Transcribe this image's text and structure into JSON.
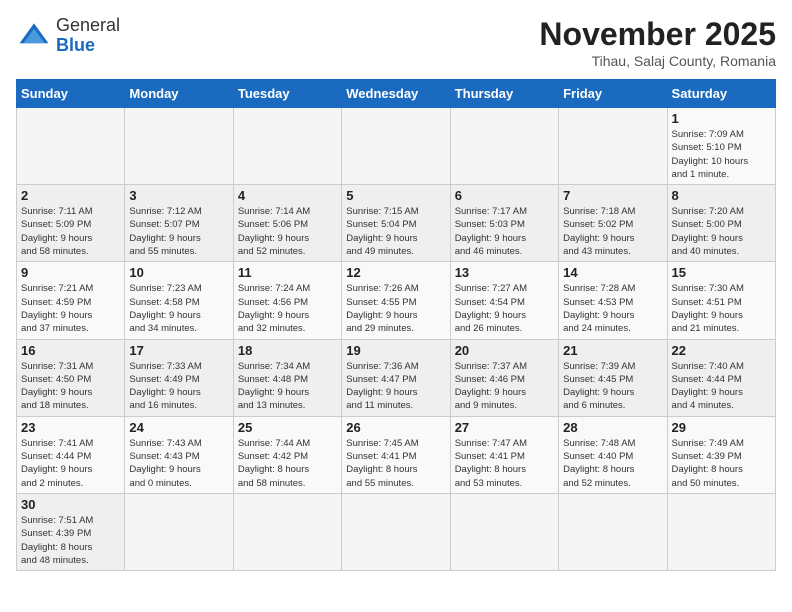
{
  "header": {
    "logo_general": "General",
    "logo_blue": "Blue",
    "month_year": "November 2025",
    "location": "Tihau, Salaj County, Romania"
  },
  "weekdays": [
    "Sunday",
    "Monday",
    "Tuesday",
    "Wednesday",
    "Thursday",
    "Friday",
    "Saturday"
  ],
  "weeks": [
    [
      {
        "day": "",
        "info": ""
      },
      {
        "day": "",
        "info": ""
      },
      {
        "day": "",
        "info": ""
      },
      {
        "day": "",
        "info": ""
      },
      {
        "day": "",
        "info": ""
      },
      {
        "day": "",
        "info": ""
      },
      {
        "day": "1",
        "info": "Sunrise: 7:09 AM\nSunset: 5:10 PM\nDaylight: 10 hours\nand 1 minute."
      }
    ],
    [
      {
        "day": "2",
        "info": "Sunrise: 7:11 AM\nSunset: 5:09 PM\nDaylight: 9 hours\nand 58 minutes."
      },
      {
        "day": "3",
        "info": "Sunrise: 7:12 AM\nSunset: 5:07 PM\nDaylight: 9 hours\nand 55 minutes."
      },
      {
        "day": "4",
        "info": "Sunrise: 7:14 AM\nSunset: 5:06 PM\nDaylight: 9 hours\nand 52 minutes."
      },
      {
        "day": "5",
        "info": "Sunrise: 7:15 AM\nSunset: 5:04 PM\nDaylight: 9 hours\nand 49 minutes."
      },
      {
        "day": "6",
        "info": "Sunrise: 7:17 AM\nSunset: 5:03 PM\nDaylight: 9 hours\nand 46 minutes."
      },
      {
        "day": "7",
        "info": "Sunrise: 7:18 AM\nSunset: 5:02 PM\nDaylight: 9 hours\nand 43 minutes."
      },
      {
        "day": "8",
        "info": "Sunrise: 7:20 AM\nSunset: 5:00 PM\nDaylight: 9 hours\nand 40 minutes."
      }
    ],
    [
      {
        "day": "9",
        "info": "Sunrise: 7:21 AM\nSunset: 4:59 PM\nDaylight: 9 hours\nand 37 minutes."
      },
      {
        "day": "10",
        "info": "Sunrise: 7:23 AM\nSunset: 4:58 PM\nDaylight: 9 hours\nand 34 minutes."
      },
      {
        "day": "11",
        "info": "Sunrise: 7:24 AM\nSunset: 4:56 PM\nDaylight: 9 hours\nand 32 minutes."
      },
      {
        "day": "12",
        "info": "Sunrise: 7:26 AM\nSunset: 4:55 PM\nDaylight: 9 hours\nand 29 minutes."
      },
      {
        "day": "13",
        "info": "Sunrise: 7:27 AM\nSunset: 4:54 PM\nDaylight: 9 hours\nand 26 minutes."
      },
      {
        "day": "14",
        "info": "Sunrise: 7:28 AM\nSunset: 4:53 PM\nDaylight: 9 hours\nand 24 minutes."
      },
      {
        "day": "15",
        "info": "Sunrise: 7:30 AM\nSunset: 4:51 PM\nDaylight: 9 hours\nand 21 minutes."
      }
    ],
    [
      {
        "day": "16",
        "info": "Sunrise: 7:31 AM\nSunset: 4:50 PM\nDaylight: 9 hours\nand 18 minutes."
      },
      {
        "day": "17",
        "info": "Sunrise: 7:33 AM\nSunset: 4:49 PM\nDaylight: 9 hours\nand 16 minutes."
      },
      {
        "day": "18",
        "info": "Sunrise: 7:34 AM\nSunset: 4:48 PM\nDaylight: 9 hours\nand 13 minutes."
      },
      {
        "day": "19",
        "info": "Sunrise: 7:36 AM\nSunset: 4:47 PM\nDaylight: 9 hours\nand 11 minutes."
      },
      {
        "day": "20",
        "info": "Sunrise: 7:37 AM\nSunset: 4:46 PM\nDaylight: 9 hours\nand 9 minutes."
      },
      {
        "day": "21",
        "info": "Sunrise: 7:39 AM\nSunset: 4:45 PM\nDaylight: 9 hours\nand 6 minutes."
      },
      {
        "day": "22",
        "info": "Sunrise: 7:40 AM\nSunset: 4:44 PM\nDaylight: 9 hours\nand 4 minutes."
      }
    ],
    [
      {
        "day": "23",
        "info": "Sunrise: 7:41 AM\nSunset: 4:44 PM\nDaylight: 9 hours\nand 2 minutes."
      },
      {
        "day": "24",
        "info": "Sunrise: 7:43 AM\nSunset: 4:43 PM\nDaylight: 9 hours\nand 0 minutes."
      },
      {
        "day": "25",
        "info": "Sunrise: 7:44 AM\nSunset: 4:42 PM\nDaylight: 8 hours\nand 58 minutes."
      },
      {
        "day": "26",
        "info": "Sunrise: 7:45 AM\nSunset: 4:41 PM\nDaylight: 8 hours\nand 55 minutes."
      },
      {
        "day": "27",
        "info": "Sunrise: 7:47 AM\nSunset: 4:41 PM\nDaylight: 8 hours\nand 53 minutes."
      },
      {
        "day": "28",
        "info": "Sunrise: 7:48 AM\nSunset: 4:40 PM\nDaylight: 8 hours\nand 52 minutes."
      },
      {
        "day": "29",
        "info": "Sunrise: 7:49 AM\nSunset: 4:39 PM\nDaylight: 8 hours\nand 50 minutes."
      }
    ],
    [
      {
        "day": "30",
        "info": "Sunrise: 7:51 AM\nSunset: 4:39 PM\nDaylight: 8 hours\nand 48 minutes."
      },
      {
        "day": "",
        "info": ""
      },
      {
        "day": "",
        "info": ""
      },
      {
        "day": "",
        "info": ""
      },
      {
        "day": "",
        "info": ""
      },
      {
        "day": "",
        "info": ""
      },
      {
        "day": "",
        "info": ""
      }
    ]
  ]
}
